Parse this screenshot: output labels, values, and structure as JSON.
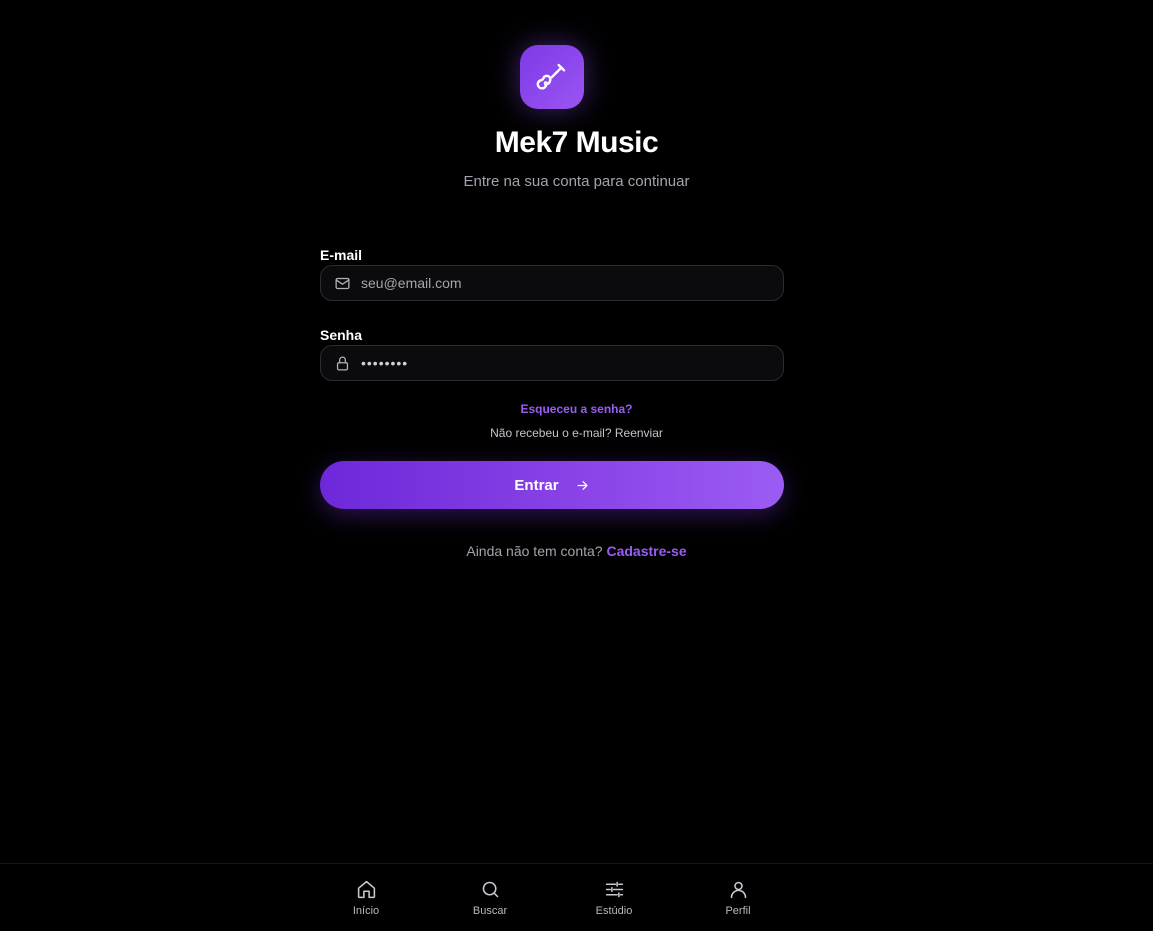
{
  "app": {
    "title": "Mek7 Music",
    "subtitle": "Entre na sua conta para continuar",
    "logo_icon": "guitar-icon",
    "accent_color": "#8b45e8"
  },
  "form": {
    "email": {
      "label": "E-mail",
      "placeholder": "seu@email.com",
      "value": "",
      "icon": "mail-icon"
    },
    "password": {
      "label": "Senha",
      "value": "••••••••",
      "icon": "lock-icon"
    },
    "forgot_link": "Esqueceu a senha?",
    "resend_prefix": "Não recebeu o e-mail?",
    "resend_link": "Reenviar",
    "submit_label": "Entrar",
    "submit_icon": "arrow-right-icon"
  },
  "signup": {
    "prompt": "Ainda não tem conta?",
    "link": "Cadastre-se"
  },
  "bottom_nav": {
    "items": [
      {
        "label": "Início",
        "icon": "home-icon"
      },
      {
        "label": "Buscar",
        "icon": "search-icon"
      },
      {
        "label": "Estúdio",
        "icon": "sliders-icon"
      },
      {
        "label": "Perfil",
        "icon": "user-icon"
      }
    ]
  }
}
